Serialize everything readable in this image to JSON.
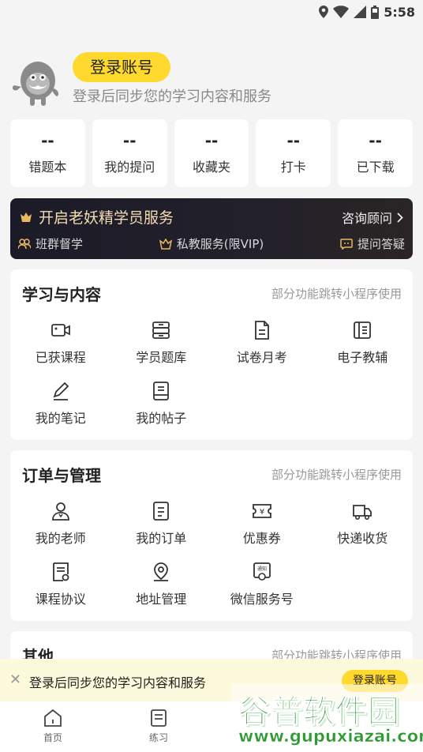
{
  "status": {
    "time": "5:58"
  },
  "profile": {
    "login_label": "登录账号",
    "login_sub": "登录后同步您的学习内容和服务"
  },
  "stats": [
    {
      "value": "--",
      "label": "错题本"
    },
    {
      "value": "--",
      "label": "我的提问"
    },
    {
      "value": "--",
      "label": "收藏夹"
    },
    {
      "value": "--",
      "label": "打卡"
    },
    {
      "value": "--",
      "label": "已下载"
    }
  ],
  "vip": {
    "title": "开启老妖精学员服务",
    "consult": "咨询顾问",
    "features": [
      "班群督学",
      "私教服务(限VIP)",
      "提问答疑"
    ]
  },
  "study": {
    "title": "学习与内容",
    "note": "部分功能跳转小程序使用",
    "items": [
      {
        "label": "已获课程",
        "icon": "video-icon"
      },
      {
        "label": "学员题库",
        "icon": "question-bank-icon"
      },
      {
        "label": "试卷月考",
        "icon": "exam-paper-icon"
      },
      {
        "label": "电子教辅",
        "icon": "ebook-icon"
      },
      {
        "label": "我的笔记",
        "icon": "pencil-icon"
      },
      {
        "label": "我的帖子",
        "icon": "post-icon"
      }
    ]
  },
  "orders": {
    "title": "订单与管理",
    "note": "部分功能跳转小程序使用",
    "items": [
      {
        "label": "我的老师",
        "icon": "teacher-icon"
      },
      {
        "label": "我的订单",
        "icon": "order-icon"
      },
      {
        "label": "优惠券",
        "icon": "coupon-icon"
      },
      {
        "label": "快递收货",
        "icon": "delivery-truck-icon"
      },
      {
        "label": "课程协议",
        "icon": "agreement-icon"
      },
      {
        "label": "地址管理",
        "icon": "location-icon"
      },
      {
        "label": "微信服务号",
        "icon": "wechat-notice-icon"
      }
    ]
  },
  "other": {
    "title": "其他",
    "note": "部分功能跳转小程序使用"
  },
  "banner": {
    "text": "登录后同步您的学习内容和服务",
    "button": "登录账号"
  },
  "tabs": [
    {
      "label": "首页",
      "icon": "home-icon"
    },
    {
      "label": "练习",
      "icon": "practice-icon"
    }
  ],
  "watermark": {
    "name": "谷普软件园",
    "url": "www.gupuxiazai.com"
  }
}
